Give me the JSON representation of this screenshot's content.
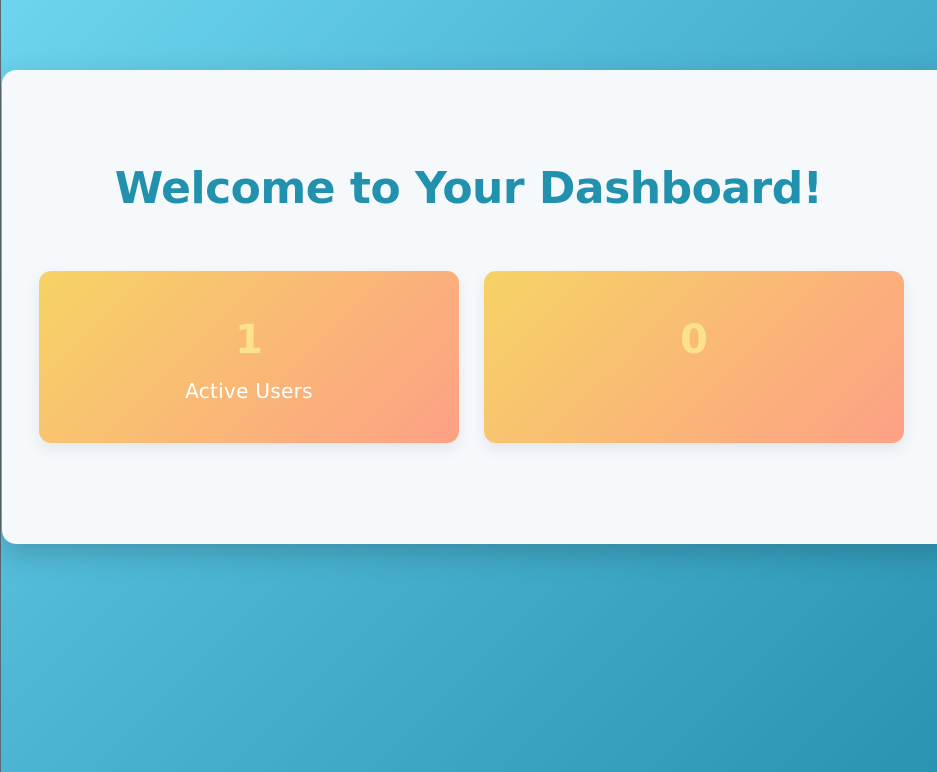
{
  "header": {
    "title": "Welcome to Your Dashboard!"
  },
  "stats": [
    {
      "value": "1",
      "label": "Active Users"
    },
    {
      "value": "0",
      "label": ""
    }
  ],
  "colors": {
    "title": "#2291ad",
    "card_gradient_start": "#f6d365",
    "card_gradient_end": "#fda085",
    "stat_value": "#fde28e"
  }
}
